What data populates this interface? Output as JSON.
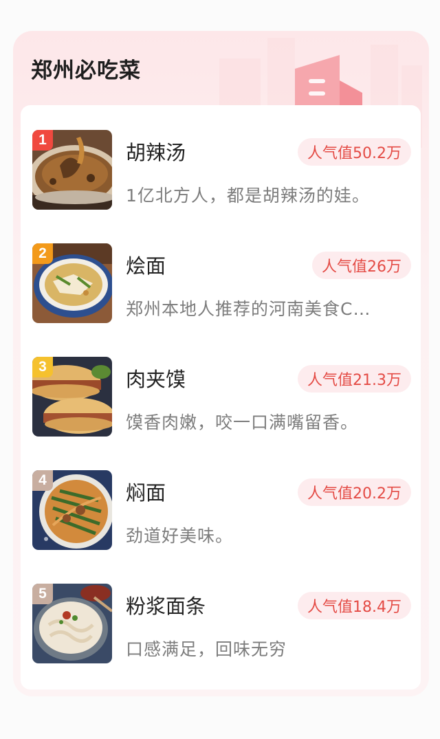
{
  "header": {
    "title": "郑州必吃菜"
  },
  "colors": {
    "rank_1": "#f0493f",
    "rank_2": "#f39a1a",
    "rank_3": "#f5c12e",
    "rank_4": "#c8aea0",
    "rank_5": "#c8aea0",
    "popularity_text": "#e44b45",
    "popularity_bg": "#fdecee"
  },
  "items": [
    {
      "rank": "1",
      "name": "胡辣汤",
      "popularity": "人气值50.2万",
      "description": "1亿北方人，都是胡辣汤的娃。"
    },
    {
      "rank": "2",
      "name": "烩面",
      "popularity": "人气值26万",
      "description": "郑州本地人推荐的河南美食C…"
    },
    {
      "rank": "3",
      "name": "肉夹馍",
      "popularity": "人气值21.3万",
      "description": "馍香肉嫩，咬一口满嘴留香。"
    },
    {
      "rank": "4",
      "name": "焖面",
      "popularity": "人气值20.2万",
      "description": "劲道好美味。"
    },
    {
      "rank": "5",
      "name": "粉浆面条",
      "popularity": "人气值18.4万",
      "description": "口感满足，回味无穷"
    }
  ]
}
